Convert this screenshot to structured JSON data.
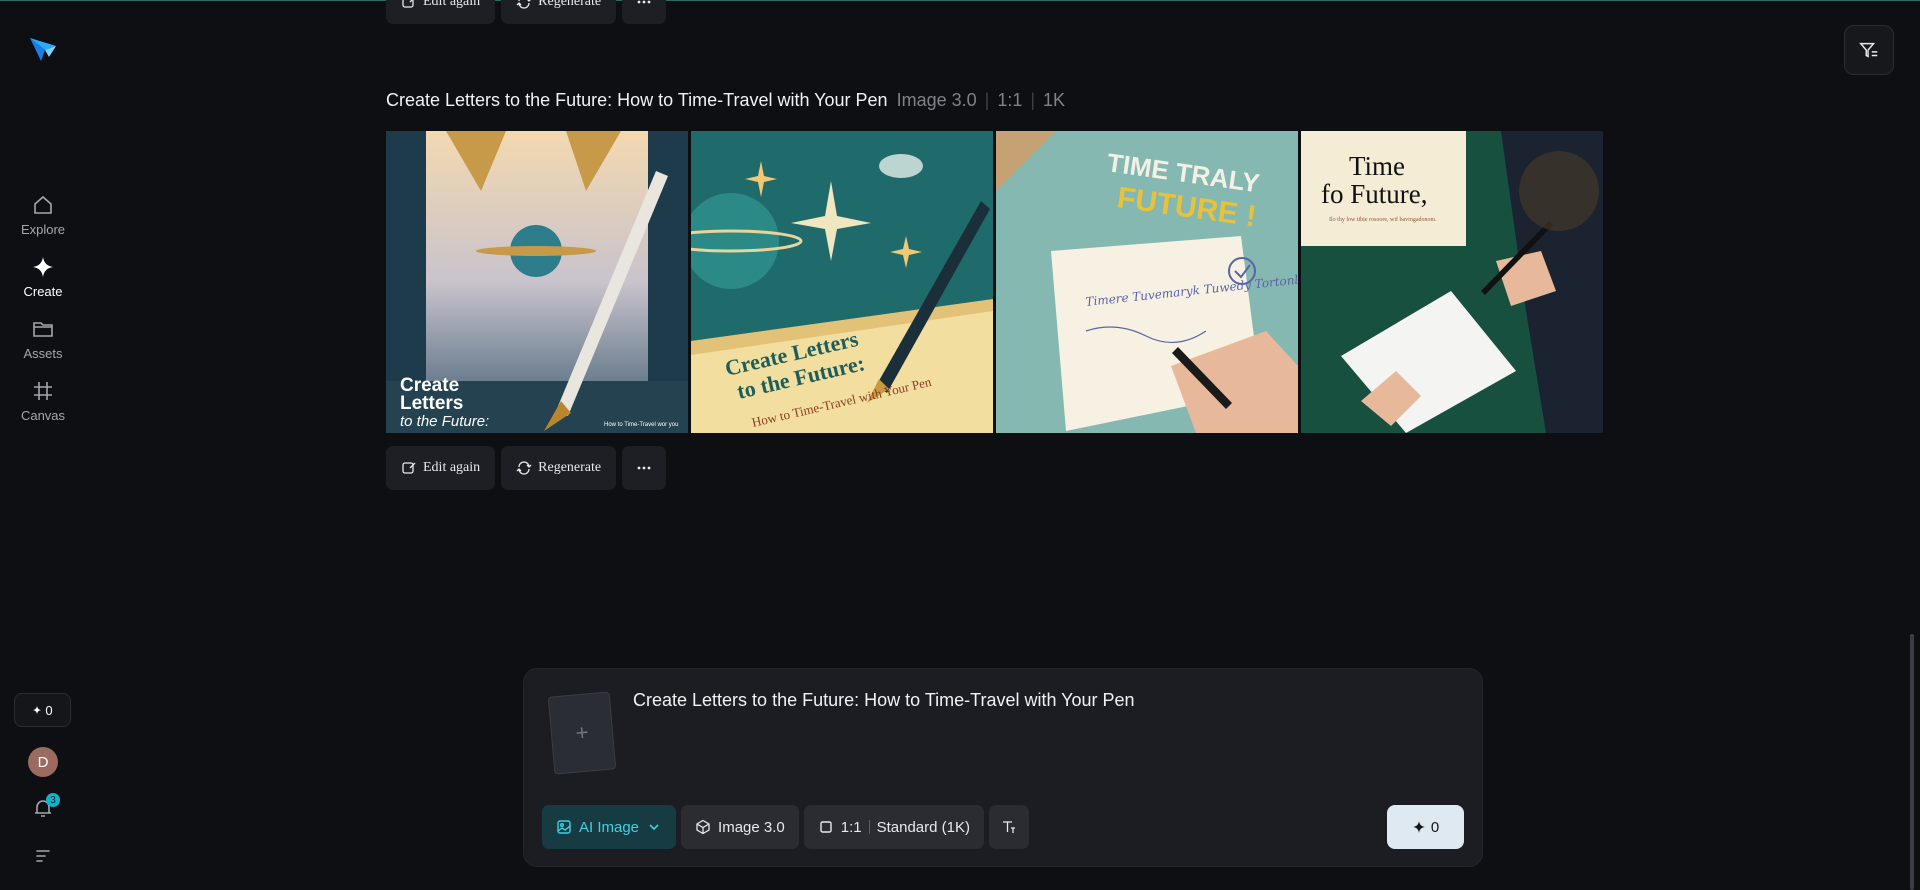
{
  "sidebar": {
    "items": [
      {
        "label": "Explore",
        "icon": "home-icon"
      },
      {
        "label": "Create",
        "icon": "sparkle-icon"
      },
      {
        "label": "Assets",
        "icon": "folder-icon"
      },
      {
        "label": "Canvas",
        "icon": "frame-icon"
      }
    ],
    "credits": "0",
    "avatar_initial": "D",
    "notification_count": "3"
  },
  "actions": {
    "edit_again": "Edit again",
    "regenerate": "Regenerate"
  },
  "generation": {
    "prompt": "Create Letters to the Future: How to Time-Travel with Your Pen",
    "model": "Image 3.0",
    "ratio": "1:1",
    "resolution": "1K"
  },
  "images": [
    {
      "alt_text_lines": [
        "Create",
        "Letters",
        "to the Future:"
      ],
      "caption": "How to Time-Travel wor you"
    },
    {
      "alt_text_lines": [
        "Create Letters",
        "to the Future:"
      ],
      "caption": "How to Time-Travel with Your Pen"
    },
    {
      "alt_text_lines": [
        "TIME TRALY",
        "FUTURE !"
      ],
      "caption": "Timere Tuvemaryk Tuwedy Tortonl"
    },
    {
      "alt_text_lines": [
        "Time",
        "fo Future,"
      ],
      "caption": "Ilo thy low tibie rosoore, wif bavingadonom."
    }
  ],
  "composer": {
    "prompt": "Create Letters to the Future: How to Time-Travel with Your Pen",
    "mode": "AI Image",
    "model": "Image 3.0",
    "ratio": "1:1",
    "quality": "Standard (1K)",
    "generate_cost": "0"
  },
  "colors": {
    "accent": "#3fd0e2",
    "background": "#0e0f12",
    "panel": "#1b1d22"
  }
}
